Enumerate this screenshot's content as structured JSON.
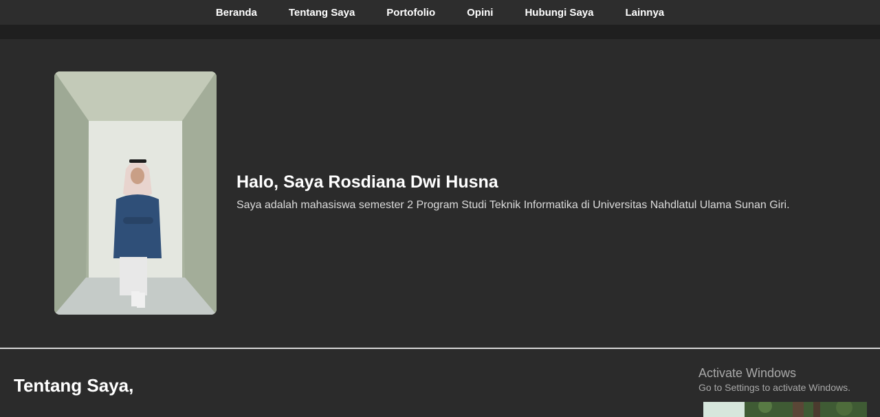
{
  "nav": {
    "items": [
      "Beranda",
      "Tentang Saya",
      "Portofolio",
      "Opini",
      "Hubungi Saya",
      "Lainnya"
    ]
  },
  "hero": {
    "title": "Halo, Saya Rosdiana Dwi Husna",
    "subtitle": "Saya adalah mahasiswa semester 2 Program Studi Teknik Informatika di Universitas Nahdlatul Ulama Sunan Giri."
  },
  "about": {
    "title": "Tentang Saya,"
  },
  "watermark": {
    "line1": "Activate Windows",
    "line2": "Go to Settings to activate Windows."
  },
  "colors": {
    "background": "#2b2b2b",
    "nav_background": "#2d2d2d",
    "text": "#ffffff",
    "divider": "#d9d9d9"
  }
}
